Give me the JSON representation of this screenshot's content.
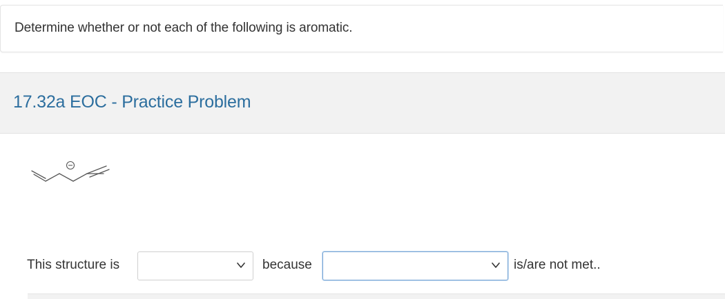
{
  "instruction": {
    "text": "Determine whether or not each of the following is aromatic."
  },
  "problem": {
    "title": "17.32a EOC - Practice Problem"
  },
  "structure": {
    "charge_symbol": "⊖"
  },
  "answer_row": {
    "prefix": "This structure is",
    "select1_value": "",
    "middle": "because",
    "select2_value": "",
    "suffix": "is/are not met.."
  },
  "icons": {
    "dropdown": "chevron-down-icon"
  },
  "colors": {
    "title_link": "#2c6e9e",
    "header_bg": "#f2f2f2",
    "focus_border": "#7aa7d6"
  }
}
